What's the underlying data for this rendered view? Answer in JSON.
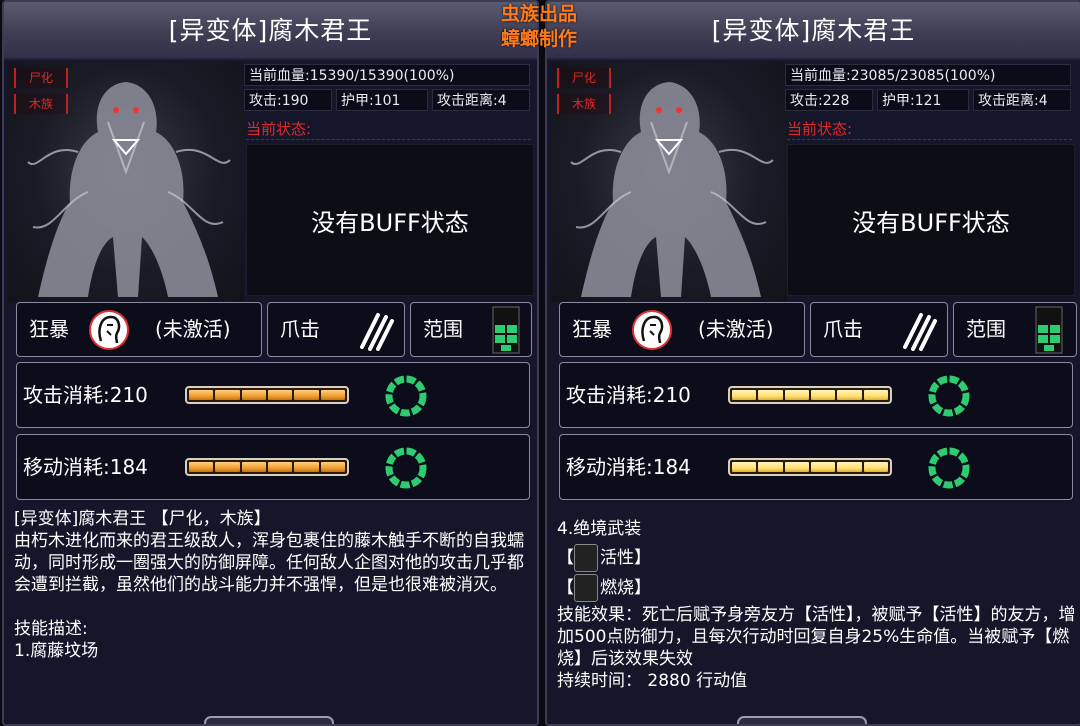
{
  "watermark": {
    "line1": "虫族出品",
    "line2": "蟑螂制作"
  },
  "left": {
    "title": "[异变体]腐木君王",
    "tags": [
      "尸化",
      "木族"
    ],
    "hp": "当前血量:15390/15390(100%)",
    "attack": "攻击:190",
    "armor": "护甲:101",
    "range": "攻击距离:4",
    "status_label": "当前状态:",
    "buff_text": "没有BUFF状态",
    "skill1_label": "狂暴",
    "skill1_state": "(未激活)",
    "skill2_label": "爪击",
    "skill3_label": "范围",
    "attack_cost": "攻击消耗:210",
    "move_cost": "移动消耗:184",
    "desc": {
      "heading": "[异变体]腐木君王 【尸化，木族】",
      "body": "由朽木进化而来的君王级敌人，浑身包裹住的藤木触手不断的自我蠕动，同时形成一圈强大的防御屏障。任何敌人企图对他的攻击几乎都会遭到拦截，虽然他们的战斗能力并不强悍，但是也很难被消灭。",
      "skill_title": "技能描述:",
      "skill_item": "1.腐藤坟场"
    }
  },
  "right": {
    "title": "[异变体]腐木君王",
    "tags": [
      "尸化",
      "木族"
    ],
    "hp": "当前血量:23085/23085(100%)",
    "attack": "攻击:228",
    "armor": "护甲:121",
    "range": "攻击距离:4",
    "status_label": "当前状态:",
    "buff_text": "没有BUFF状态",
    "skill1_label": "狂暴",
    "skill1_state": "(未激活)",
    "skill2_label": "爪击",
    "skill3_label": "范围",
    "attack_cost": "攻击消耗:210",
    "move_cost": "移动消耗:184",
    "desc": {
      "heading": "4.绝境武装",
      "buff1": "活性】",
      "buff2": "燃烧】",
      "bracket": "【",
      "effect": "技能效果：死亡后赋予身旁友方【活性】，被赋予【活性】的友方，增加500点防御力，且每次行动时回复自身25%生命值。当被赋予【燃烧】后该效果失效",
      "duration": "持续时间：  2880 行动值"
    }
  },
  "colors": {
    "accent_red": "#e02828",
    "ring_green": "#2ecc71",
    "watermark": "#ff7a1a"
  },
  "icons": [
    "monster-portrait",
    "berserk-head-icon",
    "claw-slash-icon",
    "range-grid-icon",
    "cost-ring-icon",
    "vitality-icon",
    "burn-icon"
  ]
}
